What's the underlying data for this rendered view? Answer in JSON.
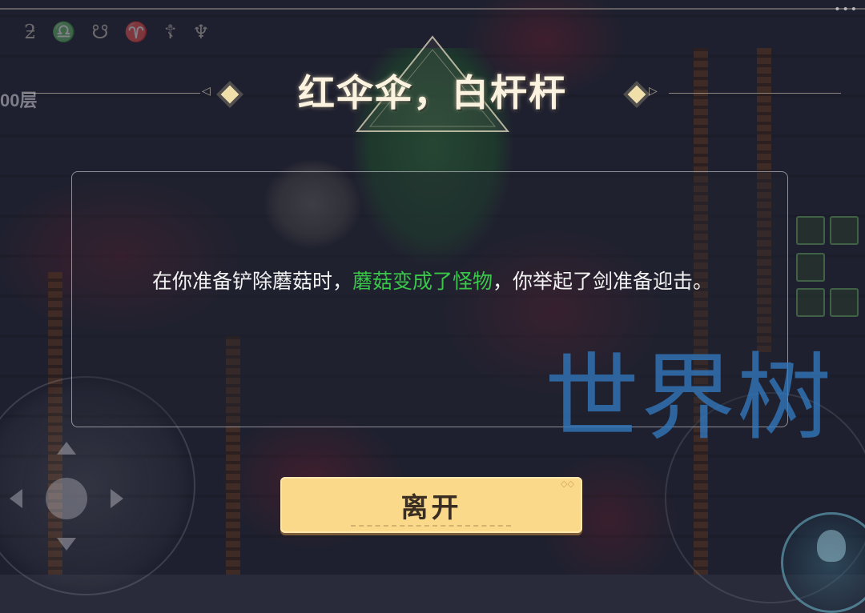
{
  "event": {
    "title": "红伞伞，白杆杆",
    "description_parts": [
      {
        "text": "在你准备铲除蘑菇时，",
        "highlight": false
      },
      {
        "text": "蘑菇变成了怪物",
        "highlight": true
      },
      {
        "text": "，你举起了剑准备迎击。",
        "highlight": false
      }
    ],
    "highlight_color": "#39c74a"
  },
  "hud": {
    "floor_label": "00层",
    "rune_symbols": "ƻ ♎ ☋ ♈ ☦ ♆",
    "menu_dots": "•••"
  },
  "actions": {
    "leave_label": "离开"
  },
  "watermark": {
    "text": "世界树"
  },
  "icons": {
    "joystick": "joystick-icon",
    "action": "flame-icon",
    "title_ornament": "diamond-icon"
  },
  "colors": {
    "button_bg": "#fbd98a",
    "title_text": "#fbf3e0",
    "watermark": "#3278be"
  }
}
